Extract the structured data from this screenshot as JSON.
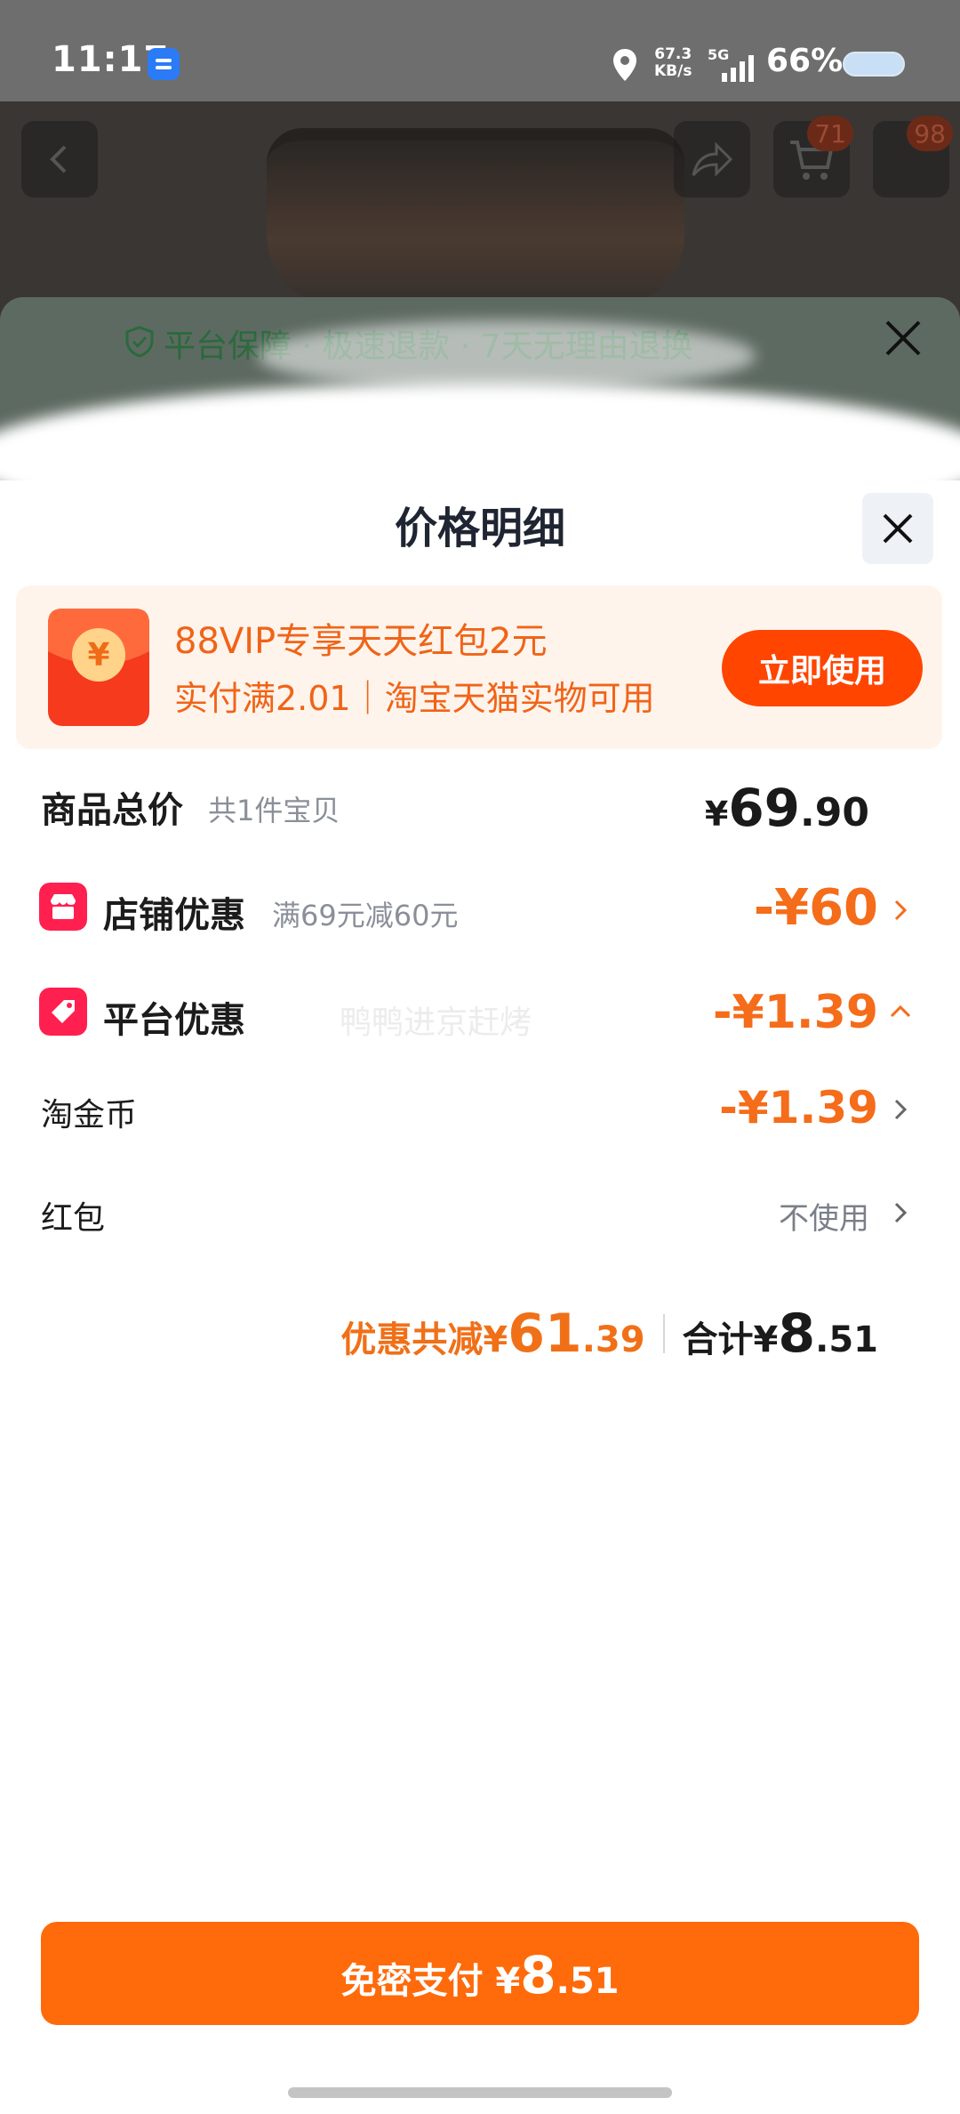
{
  "status_bar": {
    "time": "11:17",
    "speed_value": "67.3",
    "speed_unit": "KB/s",
    "network": "5G",
    "battery": "66%"
  },
  "product_header": {
    "cart_badge": "71",
    "msg_badge": "98"
  },
  "guarantee": {
    "text": "平台保障 · 极速退款 · 7天无理由退换"
  },
  "sheet": {
    "title": "价格明细"
  },
  "promo": {
    "line1": "88VIP专享天天红包2元",
    "line2": "实付满2.01｜淘宝天猫实物可用",
    "button": "立即使用",
    "icon_glyph": "¥"
  },
  "total_price": {
    "label": "商品总价",
    "sub": "共1件宝贝",
    "currency": "¥",
    "int": "69",
    "dec": ".90"
  },
  "store_discount": {
    "label": "店铺优惠",
    "sub": "满69元减60元",
    "amount": "-¥60"
  },
  "platform_discount": {
    "label": "平台优惠",
    "watermark": "鸭鸭进京赶烤",
    "amount": "-¥1.39"
  },
  "taojinbi": {
    "label": "淘金币",
    "amount": "-¥1.39"
  },
  "hongbao": {
    "label": "红包",
    "value": "不使用"
  },
  "summary": {
    "discount_label": "优惠共减¥",
    "discount_int": "61",
    "discount_dec": ".39",
    "total_label": "合计¥",
    "total_int": "8",
    "total_dec": ".51"
  },
  "pay_button": {
    "label": "免密支付 ¥",
    "int": "8",
    "dec": ".51"
  },
  "colors": {
    "accent": "#ff6a0a",
    "discount": "#f56c1a",
    "promo_button": "#ff4500"
  }
}
